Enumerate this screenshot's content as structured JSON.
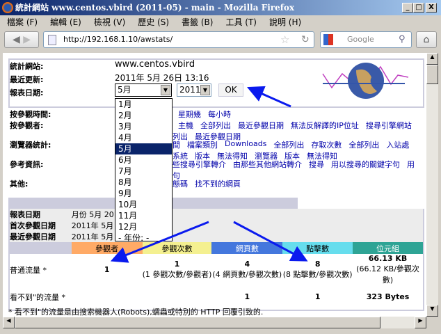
{
  "window": {
    "title": "統計網站 www.centos.vbird (2011-05) - main - Mozilla Firefox",
    "minimize": "_",
    "maximize": "□",
    "close": "X"
  },
  "menubar": [
    "檔案 (F)",
    "編輯 (E)",
    "檢視 (V)",
    "歷史 (S)",
    "書籤 (B)",
    "工具 (T)",
    "說明 (H)"
  ],
  "navbar": {
    "url": "http://192.168.1.10/awstats/",
    "search_placeholder": "Google"
  },
  "info": {
    "site_label": "統計網站:",
    "site_value": "www.centos.vbird",
    "updated_label": "最近更新:",
    "updated_value": "2011年 5月 26日 13:16",
    "date_label": "報表日期:",
    "month_selected": "5月",
    "year_selected": "2011",
    "ok_label": "OK"
  },
  "month_options": [
    "1月",
    "2月",
    "3月",
    "4月",
    "5月",
    "6月",
    "7月",
    "8月",
    "9月",
    "10月",
    "11月",
    "12月",
    "- 年份: -"
  ],
  "menu_sections": [
    {
      "label": "按參觀時間:",
      "lines": [
        [
          "星期幾",
          "每小時"
        ]
      ]
    },
    {
      "label": "按參觀者:",
      "lines": [
        [
          "主機",
          "全部列出",
          "最近參觀日期",
          "無法反解譯的IP位址",
          "搜尋引擎網站"
        ],
        [
          "列出",
          "最近參觀日期"
        ]
      ]
    },
    {
      "label": "瀏覽器統計:",
      "lines": [
        [
          "間",
          "檔案類別",
          "Downloads",
          "全部列出",
          "存取次數",
          "全部列出",
          "入站處"
        ],
        [
          "系統",
          "版本",
          "無法得知",
          "瀏覽器",
          "版本",
          "無法得知"
        ]
      ]
    },
    {
      "label": "參考資訊:",
      "lines": [
        [
          "些搜尋引擎轉介",
          "由那些其他網站轉介",
          "搜尋",
          "用以搜尋的關鍵字句",
          "用"
        ],
        [
          "句"
        ]
      ]
    },
    {
      "label": "其他:",
      "lines": [
        [
          "態碼",
          "找不到的網頁"
        ]
      ]
    }
  ],
  "summary": {
    "rows": [
      {
        "label": "報表日期",
        "value": "月份 5月 2011"
      },
      {
        "label": "首次參觀日期",
        "value": "2011年 5月"
      },
      {
        "label": "最近參觀日期",
        "value": "2011年 5月"
      }
    ],
    "headers": [
      {
        "label": "參觀者",
        "color": "#ffaa66"
      },
      {
        "label": "參觀次數",
        "color": "#f4f090"
      },
      {
        "label": "網頁數",
        "color": "#4477dd"
      },
      {
        "label": "點擊數",
        "color": "#66dded"
      },
      {
        "label": "位元組",
        "color": "#2ea495"
      }
    ],
    "traffic": [
      {
        "label": "普通流量 *",
        "cells": [
          {
            "v": "1",
            "s": ""
          },
          {
            "v": "1",
            "s": "(1 參觀次數/參觀者)"
          },
          {
            "v": "4",
            "s": "(4 網頁數/參觀次數)"
          },
          {
            "v": "8",
            "s": "(8 點擊數/參觀次數)"
          },
          {
            "v": "66.13 KB",
            "s": "(66.12 KB/參觀次數)"
          }
        ]
      },
      {
        "label": "看不到\"的流量 *",
        "cells": [
          {
            "v": "",
            "s": ""
          },
          {
            "v": "",
            "s": ""
          },
          {
            "v": "1",
            "s": ""
          },
          {
            "v": "1",
            "s": ""
          },
          {
            "v": "323 Bytes",
            "s": ""
          }
        ]
      }
    ],
    "footnote": "* 看不到\"的流量是由搜索機器人(Robots),蠕蟲或特別的 HTTP 回覆引致的."
  },
  "colors": {
    "link": "#0000aa",
    "annotation_arrow": "#0a1aee",
    "highlight": "#0a246a"
  }
}
